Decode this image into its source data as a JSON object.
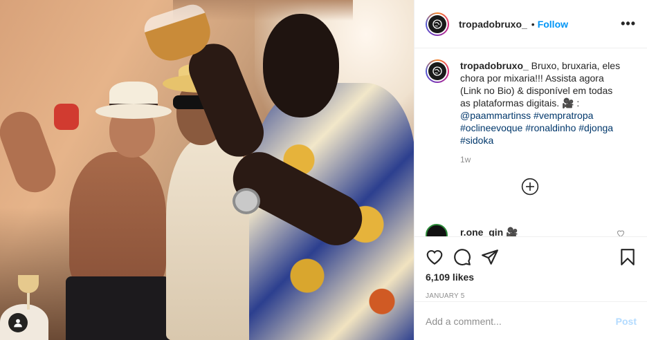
{
  "post": {
    "username": "tropadobruxo_",
    "follow_dot": "•",
    "follow_label": "Follow",
    "more_label": "•••"
  },
  "caption": {
    "username": "tropadobruxo_",
    "text": " Bruxo, bruxaria, eles chora por mixaria!!! Assista agora (Link no Bio) & disponível em todas as plataformas digitais. 🎥 : ",
    "mention": "@paammartinss",
    "hashtags": [
      "#vempratropa",
      "#oclineevoque",
      "#ronaldinho",
      "#djonga",
      "#sidoka"
    ],
    "time": "1w"
  },
  "next_comment": {
    "username": "r.one_gin 🎥"
  },
  "likes": "6,109 likes",
  "date": "JANUARY 5",
  "comment_box": {
    "placeholder": "Add a comment...",
    "post_label": "Post"
  },
  "colors": {
    "accent": "#0095f6",
    "post_disabled": "#b3dbff",
    "hashtag": "#00376b"
  },
  "icons": {
    "like": "heart-icon",
    "comment": "comment-icon",
    "share": "paper-plane-icon",
    "save": "bookmark-icon",
    "load_more": "plus-circle-icon",
    "tagged_users": "user-icon"
  }
}
